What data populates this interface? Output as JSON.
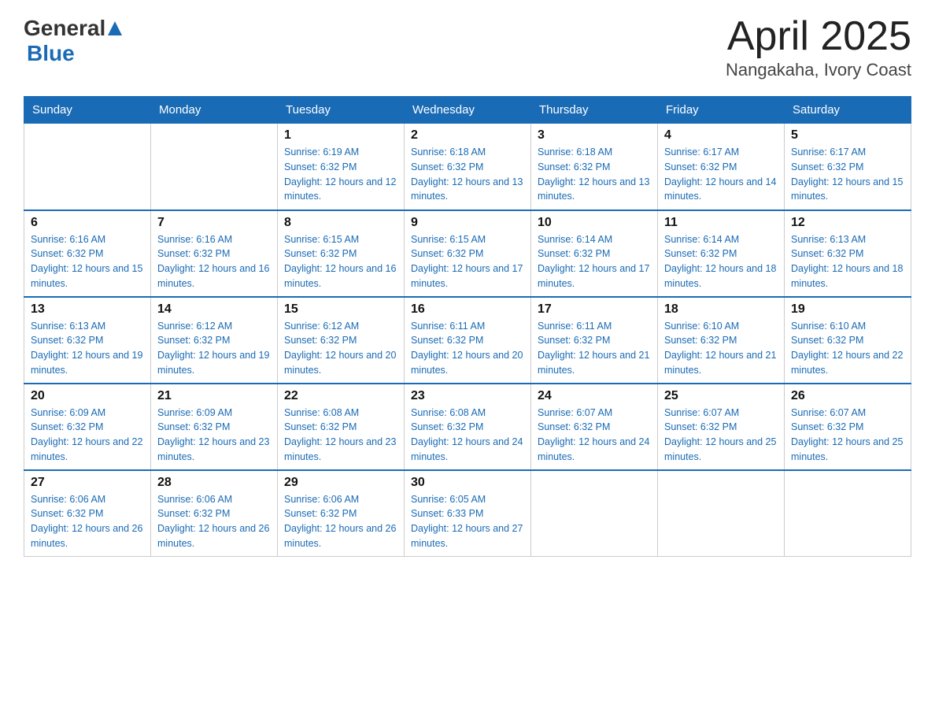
{
  "header": {
    "logo_general": "General",
    "logo_blue": "Blue",
    "month": "April 2025",
    "location": "Nangakaha, Ivory Coast"
  },
  "days_of_week": [
    "Sunday",
    "Monday",
    "Tuesday",
    "Wednesday",
    "Thursday",
    "Friday",
    "Saturday"
  ],
  "weeks": [
    [
      {
        "day": "",
        "sunrise": "",
        "sunset": "",
        "daylight": ""
      },
      {
        "day": "",
        "sunrise": "",
        "sunset": "",
        "daylight": ""
      },
      {
        "day": "1",
        "sunrise": "Sunrise: 6:19 AM",
        "sunset": "Sunset: 6:32 PM",
        "daylight": "Daylight: 12 hours and 12 minutes."
      },
      {
        "day": "2",
        "sunrise": "Sunrise: 6:18 AM",
        "sunset": "Sunset: 6:32 PM",
        "daylight": "Daylight: 12 hours and 13 minutes."
      },
      {
        "day": "3",
        "sunrise": "Sunrise: 6:18 AM",
        "sunset": "Sunset: 6:32 PM",
        "daylight": "Daylight: 12 hours and 13 minutes."
      },
      {
        "day": "4",
        "sunrise": "Sunrise: 6:17 AM",
        "sunset": "Sunset: 6:32 PM",
        "daylight": "Daylight: 12 hours and 14 minutes."
      },
      {
        "day": "5",
        "sunrise": "Sunrise: 6:17 AM",
        "sunset": "Sunset: 6:32 PM",
        "daylight": "Daylight: 12 hours and 15 minutes."
      }
    ],
    [
      {
        "day": "6",
        "sunrise": "Sunrise: 6:16 AM",
        "sunset": "Sunset: 6:32 PM",
        "daylight": "Daylight: 12 hours and 15 minutes."
      },
      {
        "day": "7",
        "sunrise": "Sunrise: 6:16 AM",
        "sunset": "Sunset: 6:32 PM",
        "daylight": "Daylight: 12 hours and 16 minutes."
      },
      {
        "day": "8",
        "sunrise": "Sunrise: 6:15 AM",
        "sunset": "Sunset: 6:32 PM",
        "daylight": "Daylight: 12 hours and 16 minutes."
      },
      {
        "day": "9",
        "sunrise": "Sunrise: 6:15 AM",
        "sunset": "Sunset: 6:32 PM",
        "daylight": "Daylight: 12 hours and 17 minutes."
      },
      {
        "day": "10",
        "sunrise": "Sunrise: 6:14 AM",
        "sunset": "Sunset: 6:32 PM",
        "daylight": "Daylight: 12 hours and 17 minutes."
      },
      {
        "day": "11",
        "sunrise": "Sunrise: 6:14 AM",
        "sunset": "Sunset: 6:32 PM",
        "daylight": "Daylight: 12 hours and 18 minutes."
      },
      {
        "day": "12",
        "sunrise": "Sunrise: 6:13 AM",
        "sunset": "Sunset: 6:32 PM",
        "daylight": "Daylight: 12 hours and 18 minutes."
      }
    ],
    [
      {
        "day": "13",
        "sunrise": "Sunrise: 6:13 AM",
        "sunset": "Sunset: 6:32 PM",
        "daylight": "Daylight: 12 hours and 19 minutes."
      },
      {
        "day": "14",
        "sunrise": "Sunrise: 6:12 AM",
        "sunset": "Sunset: 6:32 PM",
        "daylight": "Daylight: 12 hours and 19 minutes."
      },
      {
        "day": "15",
        "sunrise": "Sunrise: 6:12 AM",
        "sunset": "Sunset: 6:32 PM",
        "daylight": "Daylight: 12 hours and 20 minutes."
      },
      {
        "day": "16",
        "sunrise": "Sunrise: 6:11 AM",
        "sunset": "Sunset: 6:32 PM",
        "daylight": "Daylight: 12 hours and 20 minutes."
      },
      {
        "day": "17",
        "sunrise": "Sunrise: 6:11 AM",
        "sunset": "Sunset: 6:32 PM",
        "daylight": "Daylight: 12 hours and 21 minutes."
      },
      {
        "day": "18",
        "sunrise": "Sunrise: 6:10 AM",
        "sunset": "Sunset: 6:32 PM",
        "daylight": "Daylight: 12 hours and 21 minutes."
      },
      {
        "day": "19",
        "sunrise": "Sunrise: 6:10 AM",
        "sunset": "Sunset: 6:32 PM",
        "daylight": "Daylight: 12 hours and 22 minutes."
      }
    ],
    [
      {
        "day": "20",
        "sunrise": "Sunrise: 6:09 AM",
        "sunset": "Sunset: 6:32 PM",
        "daylight": "Daylight: 12 hours and 22 minutes."
      },
      {
        "day": "21",
        "sunrise": "Sunrise: 6:09 AM",
        "sunset": "Sunset: 6:32 PM",
        "daylight": "Daylight: 12 hours and 23 minutes."
      },
      {
        "day": "22",
        "sunrise": "Sunrise: 6:08 AM",
        "sunset": "Sunset: 6:32 PM",
        "daylight": "Daylight: 12 hours and 23 minutes."
      },
      {
        "day": "23",
        "sunrise": "Sunrise: 6:08 AM",
        "sunset": "Sunset: 6:32 PM",
        "daylight": "Daylight: 12 hours and 24 minutes."
      },
      {
        "day": "24",
        "sunrise": "Sunrise: 6:07 AM",
        "sunset": "Sunset: 6:32 PM",
        "daylight": "Daylight: 12 hours and 24 minutes."
      },
      {
        "day": "25",
        "sunrise": "Sunrise: 6:07 AM",
        "sunset": "Sunset: 6:32 PM",
        "daylight": "Daylight: 12 hours and 25 minutes."
      },
      {
        "day": "26",
        "sunrise": "Sunrise: 6:07 AM",
        "sunset": "Sunset: 6:32 PM",
        "daylight": "Daylight: 12 hours and 25 minutes."
      }
    ],
    [
      {
        "day": "27",
        "sunrise": "Sunrise: 6:06 AM",
        "sunset": "Sunset: 6:32 PM",
        "daylight": "Daylight: 12 hours and 26 minutes."
      },
      {
        "day": "28",
        "sunrise": "Sunrise: 6:06 AM",
        "sunset": "Sunset: 6:32 PM",
        "daylight": "Daylight: 12 hours and 26 minutes."
      },
      {
        "day": "29",
        "sunrise": "Sunrise: 6:06 AM",
        "sunset": "Sunset: 6:32 PM",
        "daylight": "Daylight: 12 hours and 26 minutes."
      },
      {
        "day": "30",
        "sunrise": "Sunrise: 6:05 AM",
        "sunset": "Sunset: 6:33 PM",
        "daylight": "Daylight: 12 hours and 27 minutes."
      },
      {
        "day": "",
        "sunrise": "",
        "sunset": "",
        "daylight": ""
      },
      {
        "day": "",
        "sunrise": "",
        "sunset": "",
        "daylight": ""
      },
      {
        "day": "",
        "sunrise": "",
        "sunset": "",
        "daylight": ""
      }
    ]
  ]
}
